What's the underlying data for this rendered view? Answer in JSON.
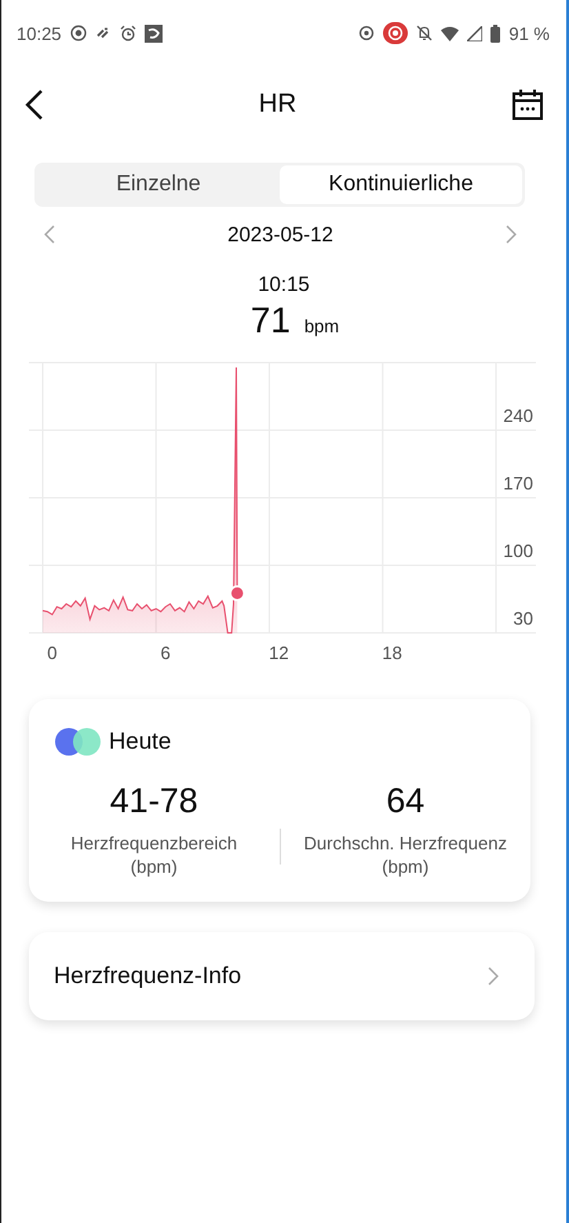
{
  "status_bar": {
    "time": "10:25",
    "battery": "91 %"
  },
  "header": {
    "title": "HR"
  },
  "tabs": [
    {
      "label": "Einzelne",
      "selected": false
    },
    {
      "label": "Kontinuierliche",
      "selected": true
    }
  ],
  "date": "2023-05-12",
  "reading": {
    "time": "10:15",
    "value": "71",
    "unit": "bpm"
  },
  "chart_data": {
    "type": "area",
    "x": [
      -0.5,
      -0.25,
      0,
      0.25,
      0.5,
      0.75,
      1,
      1.25,
      1.5,
      1.75,
      2,
      2.25,
      2.5,
      2.75,
      3,
      3.25,
      3.5,
      3.75,
      4,
      4.25,
      4.5,
      4.75,
      5,
      5.25,
      5.5,
      5.75,
      6,
      6.25,
      6.5,
      6.75,
      7,
      7.25,
      7.5,
      7.75,
      8,
      8.25,
      8.5,
      8.75,
      9,
      9.1,
      9.3,
      9.5,
      9.6,
      9.75,
      9.8
    ],
    "series": [
      {
        "color": "#e8506e",
        "values": [
          53,
          52,
          49,
          57,
          55,
          60,
          57,
          63,
          58,
          66,
          44,
          58,
          54,
          56,
          53,
          64,
          55,
          67,
          54,
          53,
          60,
          55,
          59,
          53,
          55,
          52,
          57,
          60,
          53,
          56,
          52,
          62,
          55,
          63,
          60,
          68,
          56,
          58,
          63,
          58,
          30,
          30,
          60,
          305,
          71
        ]
      }
    ],
    "xlim": [
      -0.5,
      23.5
    ],
    "ylim": [
      30,
      310
    ],
    "xticks": [
      0,
      6,
      12,
      18
    ],
    "yticks": [
      30,
      100,
      170,
      240
    ],
    "grid": true
  },
  "summary": {
    "title": "Heute",
    "stats": [
      {
        "value": "41-78",
        "label": "Herzfrequenzbereich (bpm)"
      },
      {
        "value": "64",
        "label": "Durchschn. Herzfrequenz (bpm)"
      }
    ]
  },
  "info_row": {
    "label": "Herzfrequenz-Info"
  }
}
